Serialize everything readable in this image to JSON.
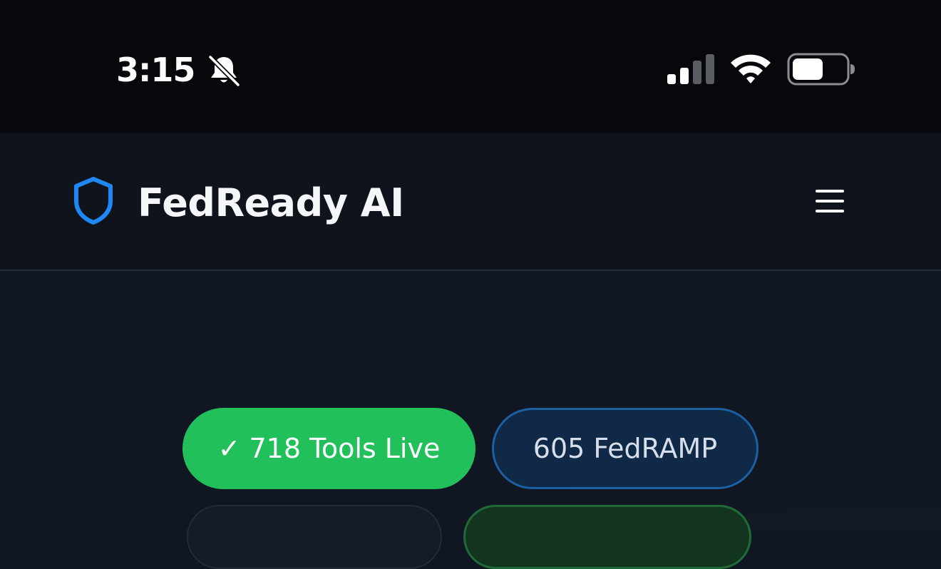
{
  "status_bar": {
    "time": "3:15",
    "icons": [
      "bell-slash-icon",
      "signal-icon",
      "wifi-icon",
      "battery-icon"
    ]
  },
  "header": {
    "logo_icon": "shield-icon",
    "brand": "FedReady AI",
    "menu_icon": "hamburger-menu-icon"
  },
  "hero": {
    "badges": [
      {
        "check": "✓",
        "label": "718 Tools Live",
        "color": "#22c05a"
      },
      {
        "label": "605 FedRAMP",
        "color": "#1d5fa3"
      }
    ]
  },
  "colors": {
    "accent_blue": "#1e88f5",
    "success_green": "#22c05a",
    "background": "#111722"
  }
}
